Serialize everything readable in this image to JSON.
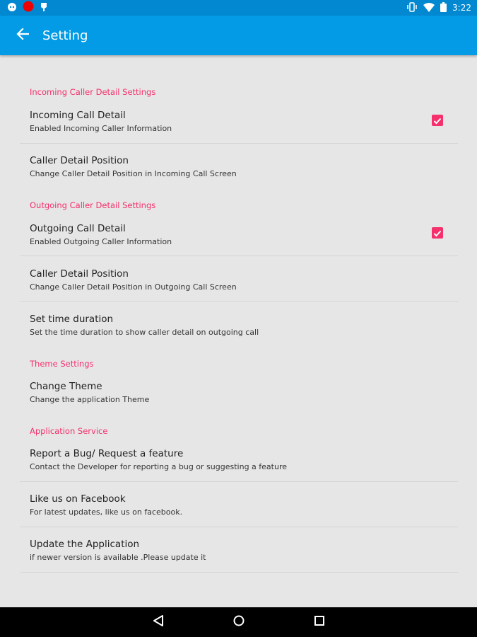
{
  "status_bar": {
    "time": "3:22",
    "left_icons": [
      "chat-icon",
      "record-icon",
      "tip-icon"
    ],
    "right_icons": [
      "vibrate-icon",
      "wifi-icon",
      "battery-icon"
    ]
  },
  "app_bar": {
    "title": "Setting",
    "background": "#039be5"
  },
  "accent_color": "#f5306c",
  "sections": [
    {
      "header": "Incoming Caller Detail Settings",
      "items": [
        {
          "title": "Incoming Call Detail",
          "summary": "Enabled Incoming Caller Information",
          "checked": true
        },
        {
          "title": "Caller Detail Position",
          "summary": "Change Caller Detail Position in Incoming Call Screen"
        }
      ]
    },
    {
      "header": "Outgoing Caller Detail Settings",
      "items": [
        {
          "title": "Outgoing Call Detail",
          "summary": "Enabled Outgoing Caller Information",
          "checked": true
        },
        {
          "title": "Caller Detail Position",
          "summary": "Change Caller Detail Position in Outgoing Call Screen"
        },
        {
          "title": "Set time duration",
          "summary": "Set the time duration to show caller detail on outgoing call"
        }
      ]
    },
    {
      "header": "Theme Settings",
      "items": [
        {
          "title": "Change Theme",
          "summary": "Change the application Theme"
        }
      ]
    },
    {
      "header": "Application Service",
      "items": [
        {
          "title": "Report a Bug/ Request a feature",
          "summary": "Contact the Developer for reporting a bug or suggesting a feature"
        },
        {
          "title": "Like us on Facebook",
          "summary": "For latest updates, like us on facebook."
        },
        {
          "title": "Update the Application",
          "summary": "if newer version is available .Please update it"
        }
      ]
    }
  ],
  "nav_bar": {
    "buttons": [
      "back-icon",
      "home-icon",
      "recents-icon"
    ]
  }
}
